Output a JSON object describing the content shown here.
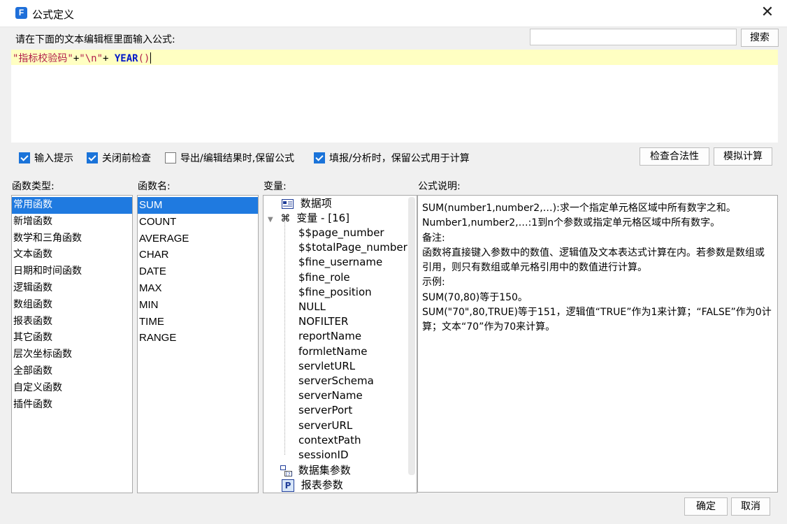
{
  "window": {
    "title": "公式定义",
    "app_icon": "F",
    "close_glyph": "✕"
  },
  "prompt": "请在下面的文本编辑框里面输入公式:",
  "search": {
    "button_label": "搜索",
    "value": ""
  },
  "editor": {
    "formula_parts": [
      "\"指标校验码\"",
      "+",
      "\"\\n\"",
      "+ ",
      "YEAR",
      "()"
    ]
  },
  "options": [
    {
      "label": "输入提示",
      "checked": true
    },
    {
      "label": "关闭前检查",
      "checked": true
    },
    {
      "label": "导出/编辑结果时,保留公式",
      "checked": false
    },
    {
      "label": "填报/分析时，保留公式用于计算",
      "checked": true
    }
  ],
  "buttons": {
    "check": "检查合法性",
    "simulate": "模拟计算",
    "ok": "确定",
    "cancel": "取消"
  },
  "labels": {
    "func_type": "函数类型:",
    "func_name": "函数名:",
    "variables": "变量:",
    "description": "公式说明:"
  },
  "func_types": [
    "常用函数",
    "新增函数",
    "数学和三角函数",
    "文本函数",
    "日期和时间函数",
    "逻辑函数",
    "数组函数",
    "报表函数",
    "其它函数",
    "层次坐标函数",
    "全部函数",
    "自定义函数",
    "插件函数"
  ],
  "func_types_selected": 0,
  "func_names": [
    "SUM",
    "COUNT",
    "AVERAGE",
    "CHAR",
    "DATE",
    "MAX",
    "MIN",
    "TIME",
    "RANGE"
  ],
  "func_names_selected": 0,
  "variables": {
    "data_item": "数据项",
    "group_label": "变量 - [16]",
    "group_icon": "variable-icon",
    "items": [
      "$$page_number",
      "$$totalPage_number",
      "$fine_username",
      "$fine_role",
      "$fine_position",
      "NULL",
      "NOFILTER",
      "reportName",
      "formletName",
      "servletURL",
      "serverSchema",
      "serverName",
      "serverPort",
      "serverURL",
      "contextPath",
      "sessionID"
    ],
    "dataset_params": "数据集参数",
    "report_params": "报表参数"
  },
  "description": [
    "SUM(number1,number2,…):求一个指定单元格区域中所有数字之和。",
    "Number1,number2,…:1到n个参数或指定单元格区域中所有数字。",
    "备注:",
    "函数将直接键入参数中的数值、逻辑值及文本表达式计算在内。若参数是数组或引用，则只有数组或单元格引用中的数值进行计算。",
    "示例:",
    "SUM(70,80)等于150。",
    "SUM(\"70\",80,TRUE)等于151，逻辑值“TRUE”作为1来计算；“FALSE”作为0计算；文本“70”作为70来计算。"
  ],
  "colors": {
    "accent": "#1f7ae0",
    "editor_highlight": "#ffffc2",
    "string": "#b21f4c",
    "keyword": "#0018c8"
  }
}
